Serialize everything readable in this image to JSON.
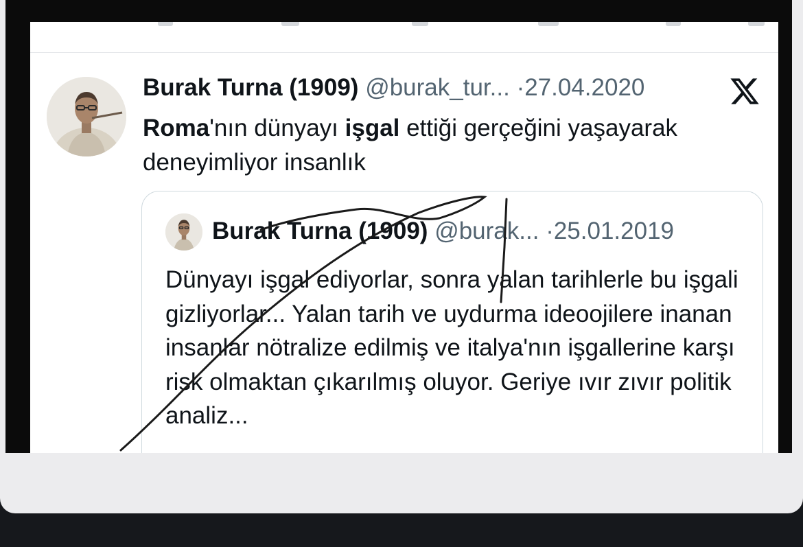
{
  "tweet": {
    "author_name": "Burak Turna (1909)",
    "handle": "@burak_tur...",
    "separator": "·",
    "date": "27.04.2020",
    "text_parts": [
      "Roma",
      "'nın dünyayı ",
      "işgal",
      " ettiği gerçeğini yaşayarak deneyimliyor insanlık"
    ]
  },
  "quoted_tweet": {
    "author_name": "Burak Turna (1909)",
    "handle": "@burak...",
    "separator": "·",
    "date": "25.01.2019",
    "text": "Dünyayı işgal ediyorlar, sonra yalan tarihlerle bu işgali gizliyorlar... Yalan tarih ve uydurma ideoojilere inanan insanlar nötralize edilmiş ve italya'nın işgallerine karşı risk olmaktan çıkarılmış oluyor. Geriye ıvır zıvır politik analiz..."
  },
  "icons": {
    "platform_logo": "x-logo-icon",
    "avatar": "avatar-icon"
  },
  "colors": {
    "text": "#0f1419",
    "muted": "#536471",
    "border": "#cfd9de",
    "page_bg": "#16181c",
    "card_bg": "#ececee"
  }
}
